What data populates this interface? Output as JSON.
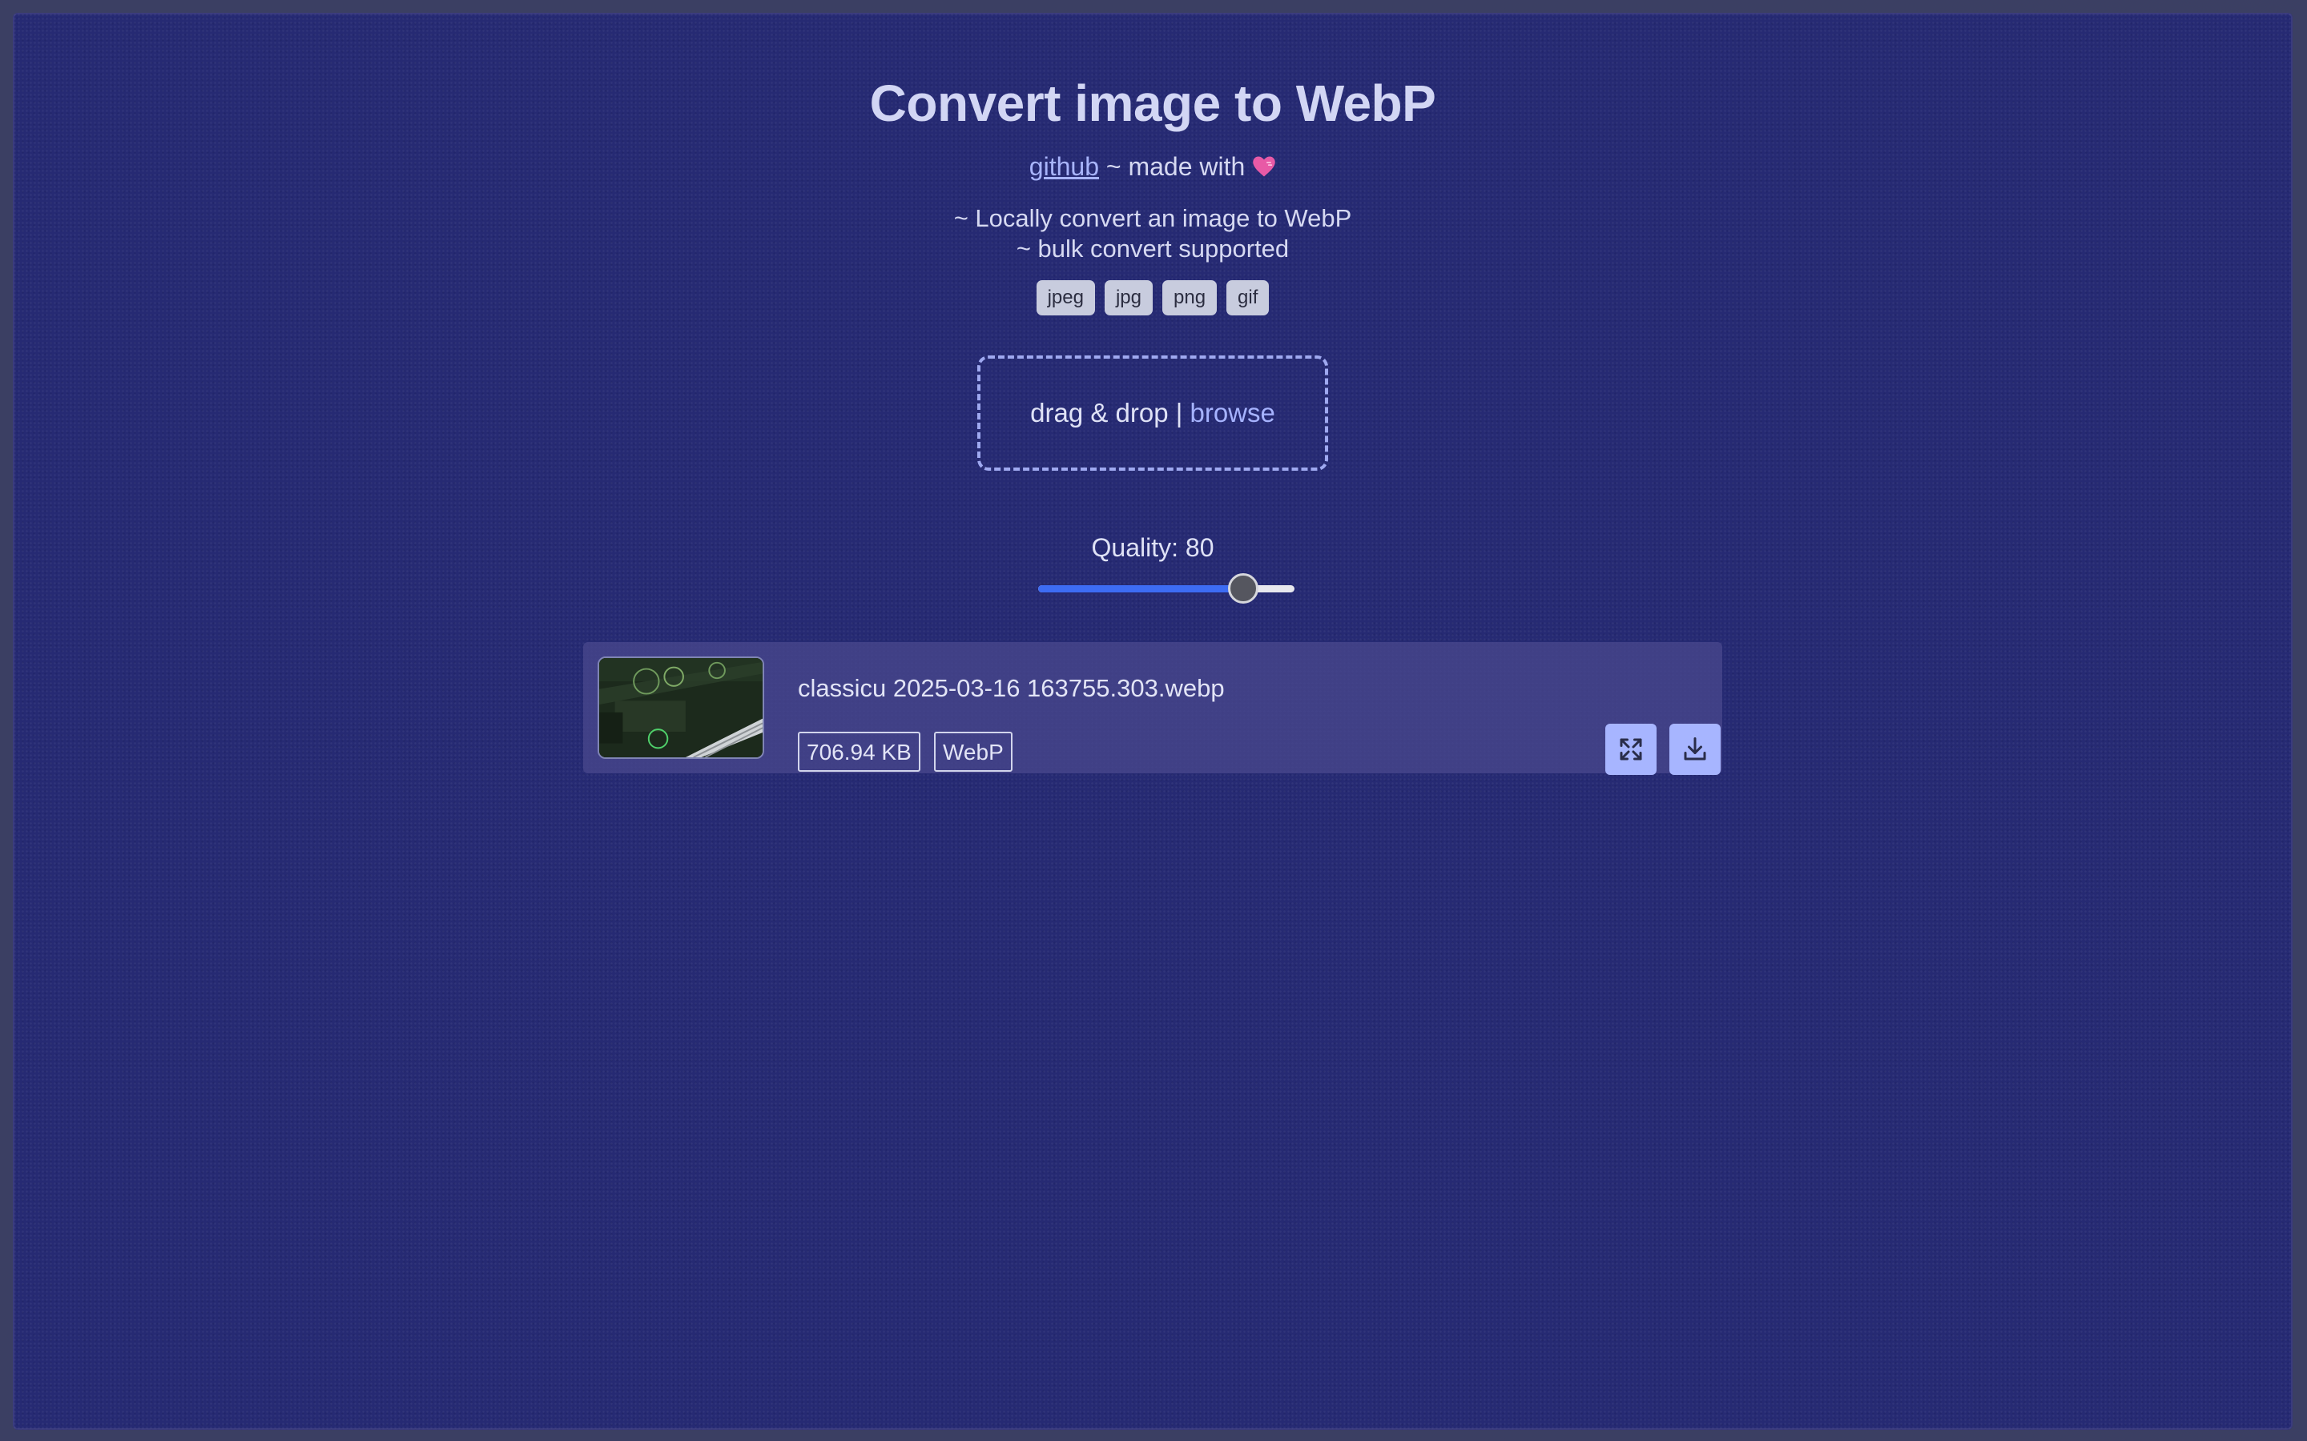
{
  "header": {
    "title": "Convert image to WebP",
    "github_link": "github",
    "made_with": " ~ made with ",
    "description_line1": "~ Locally convert an image to WebP",
    "description_line2": "~ bulk convert supported"
  },
  "formats": [
    "jpeg",
    "jpg",
    "png",
    "gif"
  ],
  "dropzone": {
    "text": "drag & drop | ",
    "browse_label": "browse"
  },
  "quality": {
    "label": "Quality: 80",
    "value": 80,
    "min": 0,
    "max": 100
  },
  "files": [
    {
      "name": "classicu 2025-03-16 163755.303.webp",
      "size": "706.94 KB",
      "format": "WebP"
    }
  ],
  "icons": {
    "heart": "heart-icon",
    "expand": "expand-icon",
    "download": "download-icon"
  },
  "colors": {
    "background": "#262a73",
    "accent": "#a7b5ff",
    "slider_fill": "#3d6cf4"
  }
}
